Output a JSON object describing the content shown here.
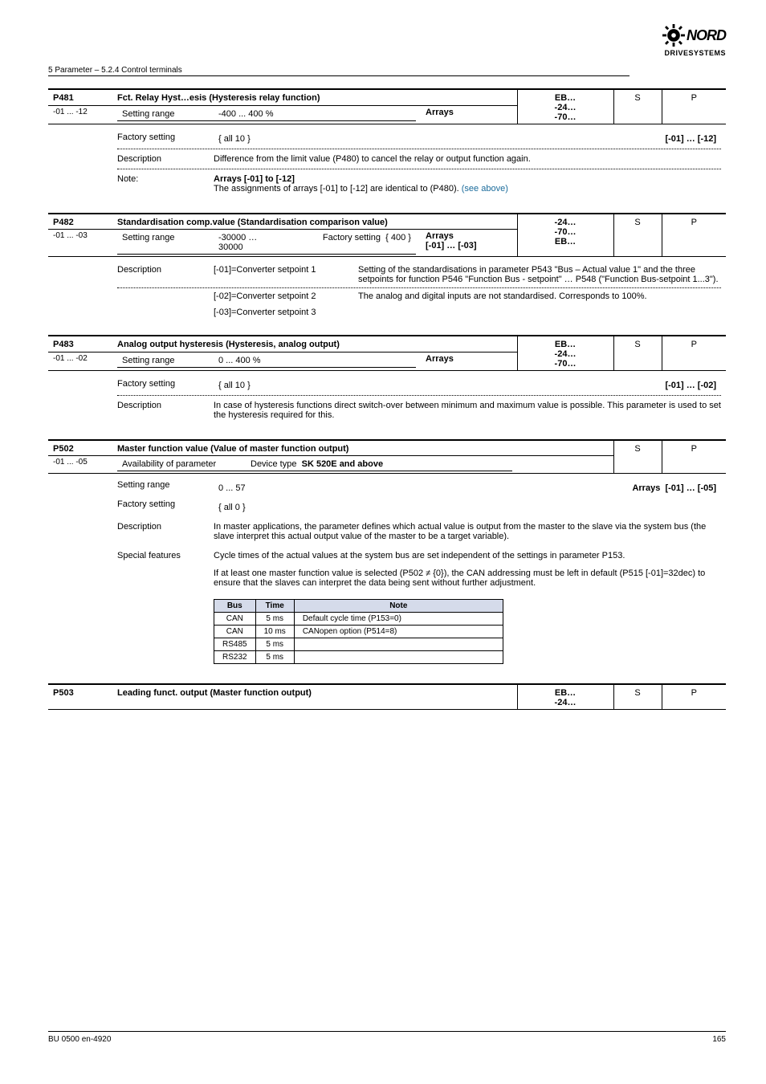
{
  "page_header": "5 Parameter – 5.2.4 Control terminals",
  "logo": {
    "brand": "NORD",
    "sub": "DRIVESYSTEMS"
  },
  "footer": {
    "left": "BU 0500 en-4920",
    "right": "165"
  },
  "p481": {
    "code": "P481",
    "name": "Fct. Relay Hyst…esis (Hysteresis relay function)",
    "avail": "EB…\n-24…\n-70…",
    "s": "S",
    "p": "P",
    "left1": "-01 ... -12",
    "range": "Setting range",
    "range_val": "-400 ... 400 %",
    "array": "Arrays",
    "array_val": "[-01] … [-12]",
    "factory": "Factory setting",
    "factory_val": "{ all 10 }",
    "desc": "Description",
    "desc_val": "Difference from the limit value (P480) to cancel the relay or output function again.",
    "note_left": "Note:",
    "note_head": "Arrays [-01] to [-12]",
    "note_body": "The assignments of arrays [-01] to [-12] are identical to (P480). ",
    "note_link": "(see above)"
  },
  "p482": {
    "code": "P482",
    "name": "Standardisation comp.value (Standardisation comparison value)",
    "avail": "-24…\n-70…\nEB…",
    "s": "S",
    "p": "P",
    "left1": "-01 ... -03",
    "range": "Setting range",
    "range_val": "-30000 … 30000",
    "factory": "Factory setting",
    "factory_val": "{ 400 }",
    "array": "Arrays",
    "array_val": "[-01] … [-03]",
    "desc": "Description",
    "desc_row1_left": "[-01]=Converter setpoint 1",
    "desc_row1_right": "Setting of the standardisations in parameter P543 \"Bus – Actual value 1\" and the three setpoints for function P546 \"Function Bus - setpoint\" … P548 (\"Function Bus-setpoint 1...3\").",
    "desc_row2_left": "[-02]=Converter setpoint 2",
    "desc_row2_right": "The analog and digital inputs are not standardised. Corresponds to 100%.",
    "desc_row3_left": "[-03]=Converter setpoint 3",
    "desc_row3_right": ""
  },
  "p483": {
    "code": "P483",
    "name": "Analog output hysteresis (Hysteresis, analog output)",
    "avail": "EB…\n-24…\n-70…",
    "s": "S",
    "p": "P",
    "left1": "-01 ... -02",
    "range": "Setting range",
    "range_val": "0 ... 400 %",
    "array": "Arrays",
    "array_val": "[-01] … [-02]",
    "factory": "Factory setting",
    "factory_val": "{ all 10 }",
    "desc": "Description",
    "desc_val": "In case of hysteresis functions direct switch-over between minimum and maximum value is possible. This parameter is used to set the hysteresis required for this."
  },
  "p502": {
    "code": "P502",
    "name": "Master function value (Value of master function output)",
    "avail_label": "Availability of parameter",
    "avail_type": "Device type",
    "avail_type_val": "SK 520E and above",
    "s": "S",
    "p": "P",
    "left1": "-01 ... -05",
    "range": "Setting range",
    "range_val": "0 ... 57",
    "array": "Arrays",
    "array_val": "[-01] … [-05]",
    "factory": "Factory setting",
    "factory_val": "{ all 0 }",
    "desc": "Description",
    "desc_val": "In master applications, the parameter defines which actual value is output from the master to the slave via the system bus (the slave interpret this actual output value of the master to be a target variable).",
    "special": "Special features",
    "special_val1": "Cycle times of the actual values at the system bus are set independent of the settings in parameter P153.",
    "special_val2": "If at least one master function value is selected (P502 ≠ {0}), the CAN addressing must be left in default (P515 [-01]=32dec) to ensure that the slaves can interpret the data being sent without further adjustment.",
    "tbl": {
      "h_bus": "Bus",
      "h_time": "Time",
      "h_note": "Note",
      "r1": {
        "bus": "CAN",
        "time": "5 ms",
        "note": "Default cycle time (P153=0)"
      },
      "r2": {
        "bus": "CAN",
        "time": "10 ms",
        "note": "CANopen option (P514=8)"
      },
      "r3": {
        "bus": "RS485",
        "time": "5 ms",
        "note": ""
      },
      "r4": {
        "bus": "RS232",
        "time": "5 ms",
        "note": ""
      }
    }
  },
  "p503": {
    "code": "P503",
    "name": "Leading funct. output (Master function output)",
    "avail": "EB…\n-24…",
    "s": "S",
    "p": "P"
  }
}
